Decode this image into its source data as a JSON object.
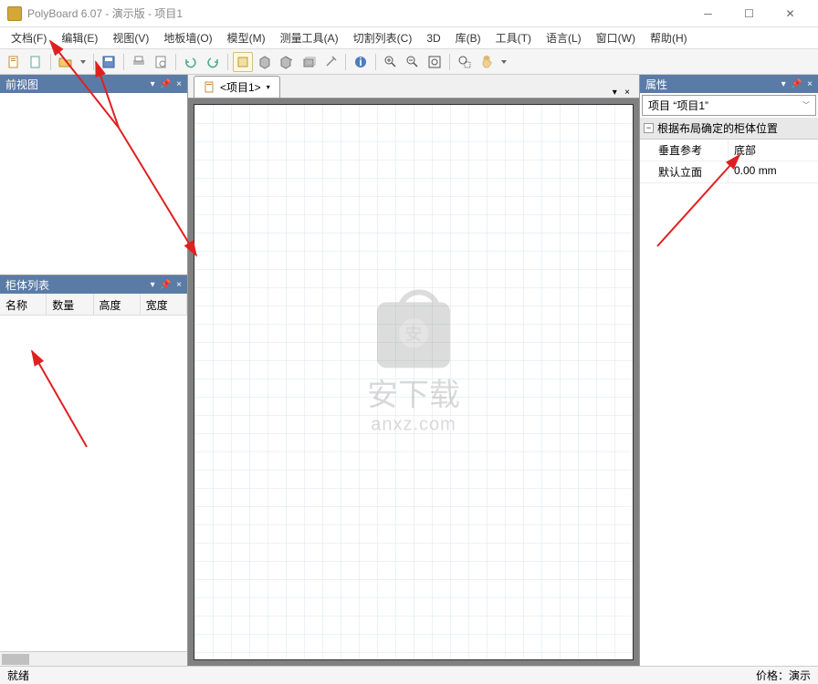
{
  "window": {
    "title": "PolyBoard 6.07 - 演示版  - 项目1"
  },
  "menu": {
    "file": "文档(F)",
    "edit": "编辑(E)",
    "view": "视图(V)",
    "floor": "地板墙(O)",
    "model": "模型(M)",
    "measure": "测量工具(A)",
    "cutlist": "切割列表(C)",
    "threeD": "3D",
    "library": "库(B)",
    "tools": "工具(T)",
    "language": "语言(L)",
    "window_menu": "窗口(W)",
    "help": "帮助(H)"
  },
  "panels": {
    "front_view": "前视图",
    "cabinet_list": "柜体列表",
    "properties": "属性"
  },
  "cabinet_columns": {
    "name": "名称",
    "qty": "数量",
    "height": "高度",
    "width": "宽度"
  },
  "doc_tab": {
    "label": "<项目1>"
  },
  "properties": {
    "selector": "项目 “项目1”",
    "group": "根据布局确定的柜体位置",
    "rows": [
      {
        "name": "垂直参考",
        "value": "底部"
      },
      {
        "name": "默认立面",
        "value": "0.00 mm"
      }
    ]
  },
  "status": {
    "ready": "就绪",
    "price": "价格：演示"
  },
  "watermark": {
    "cn": "安下载",
    "en": "anxz.com",
    "letter": "安"
  },
  "icons": {
    "new": "new-doc",
    "open": "open",
    "save": "save",
    "print": "print",
    "copy": "copy",
    "paste": "paste",
    "undo": "undo",
    "redo": "redo",
    "zoomin": "zoom-in",
    "zoomout": "zoom-out",
    "zoomfit": "zoom-fit",
    "zoomregion": "zoom-region",
    "pan": "pan",
    "info": "info"
  }
}
